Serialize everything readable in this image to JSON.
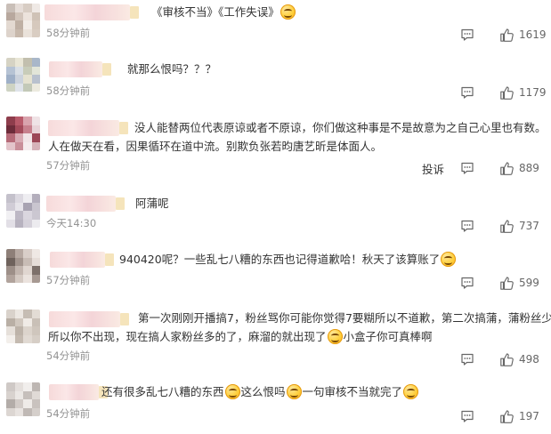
{
  "comments": [
    {
      "text_parts": [
        "《审核不当》《工作失误》"
      ],
      "emoji_after": [
        true
      ],
      "time": "58分钟前",
      "likes": "1619",
      "avatar_colors": [
        "#c9bfb8",
        "#e6ddd8",
        "#d8cdc4",
        "#efe9e5",
        "#b8a89e",
        "#d2c5bb",
        "#ece3dc",
        "#cfc2b6",
        "#e3d9d1",
        "#bfb0a4",
        "#f2ece7",
        "#d6c9bd",
        "#ddd3cb",
        "#c7b8ab",
        "#eae2da",
        "#d9cdc2"
      ]
    },
    {
      "text_parts": [
        "就那么恨吗？？？"
      ],
      "emoji_after": [
        false
      ],
      "time": "58分钟前",
      "likes": "1179",
      "avatar_colors": [
        "#d6d3c4",
        "#e9e6d6",
        "#c2bfae",
        "#a9b7c9",
        "#b6c3d4",
        "#d9dfe6",
        "#c8ccb9",
        "#e2e5d8",
        "#9fb0c7",
        "#cbd2dc",
        "#e5e2d0",
        "#b9c1ce",
        "#ced3c3",
        "#dfe3ea",
        "#c3c9b8",
        "#eceadf"
      ]
    },
    {
      "text_parts": [
        "没人能替两位代表原谅或者不原谅，你们做这种事是不是故意为之自己心里也有数。",
        "人在做天在看，因果循环在道中流。别欺负张若昀唐艺昕是体面人。"
      ],
      "emoji_after": [
        false,
        false
      ],
      "time": "57分钟前",
      "likes": "889",
      "report": "投诉",
      "avatar_colors": [
        "#8e3d4c",
        "#b85a6a",
        "#d9a3ad",
        "#efe3e6",
        "#6d2c3a",
        "#a34a5a",
        "#c7808d",
        "#e8d3d8",
        "#b66a78",
        "#d8aab3",
        "#f1e4e7",
        "#9c4757",
        "#e3c4ca",
        "#c98f9a",
        "#f5ecee",
        "#d6b2b9"
      ]
    },
    {
      "text_parts": [
        "阿蒲呢"
      ],
      "emoji_after": [
        false
      ],
      "time": "今天14:30",
      "likes": "737",
      "avatar_colors": [
        "#c4c1cb",
        "#dcd9e1",
        "#eeedf1",
        "#b3aebc",
        "#d0ccd6",
        "#e6e4ea",
        "#a8a3b2",
        "#c9c5cf",
        "#f1f0f3",
        "#bdb8c5",
        "#dad6df",
        "#cbc7d1",
        "#e2dfe6",
        "#b7b2bf",
        "#d5d1da",
        "#ecebef"
      ]
    },
    {
      "text_parts": [
        "940420呢？一些乱七八糟的东西也记得道歉哈！秋天了该算账了"
      ],
      "emoji_after": [
        true
      ],
      "time": "57分钟前",
      "likes": "599",
      "avatar_colors": [
        "#8e7f78",
        "#b7a9a2",
        "#d9cec8",
        "#efe8e4",
        "#6f625c",
        "#a2948d",
        "#c8bcb5",
        "#e6ddd8",
        "#9d8f88",
        "#c2b5ae",
        "#e0d6d0",
        "#7d706a",
        "#b1a39c",
        "#d4c9c2",
        "#ebe3de",
        "#a79992"
      ]
    },
    {
      "text_parts": [
        "第一次刚刚开播搞7，粉丝骂你可能你觉得7要糊所以不道歉，第二次搞蒲，蒲粉丝少",
        "所以你不出现，现在搞人家粉丝多的了，麻溜的就出现了",
        "小盒子你可真棒啊"
      ],
      "emoji_after": [
        false,
        true,
        false
      ],
      "time": "54分钟前",
      "likes": "498",
      "avatar_colors": [
        "#d9d2cb",
        "#ece7e2",
        "#c6bdb4",
        "#e3dcd5",
        "#b9afa5",
        "#d1c8bf",
        "#f0ebe6",
        "#c9c0b7",
        "#e6e0da",
        "#bdb3a9",
        "#dcd4cc",
        "#cfc6bd",
        "#f3efeb",
        "#c4bab0",
        "#e1dad3",
        "#d6cec6"
      ]
    },
    {
      "text_parts": [
        "还有很多乱七八糟的东西",
        "这么恨吗",
        "一句审核不当就完了"
      ],
      "emoji_after": [
        true,
        true,
        true
      ],
      "time": "54分钟前",
      "likes": "197",
      "avatar_colors": [
        "#cfc9c6",
        "#e4dfdc",
        "#f1eeec",
        "#bdb6b2",
        "#d8d2ce",
        "#ebe7e4",
        "#c6bfbb",
        "#e0dad6",
        "#b3aca8",
        "#d2cbc7",
        "#efebe8",
        "#c9c2be",
        "#dcd6d2",
        "#e8e3e0",
        "#c0b9b5",
        "#d5cfcb"
      ]
    }
  ]
}
